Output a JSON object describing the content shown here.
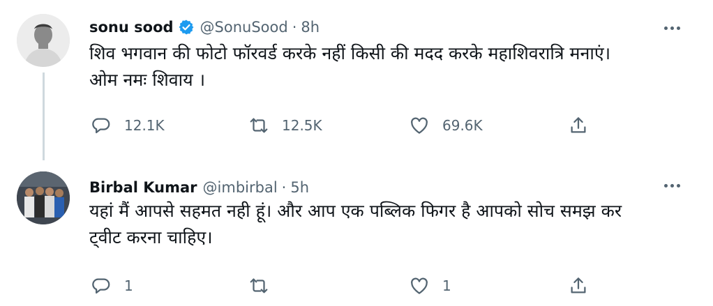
{
  "tweets": [
    {
      "name": "sonu sood",
      "handle": "@SonuSood",
      "separator": "·",
      "time": "8h",
      "text": "शिव भगवान की फोटो फॉरवर्ड करके नहीं किसी की मदद करके महाशिवरात्रि मनाएं।\n ओम नमः शिवाय ।",
      "verified": true,
      "replies": "12.1K",
      "retweets": "12.5K",
      "likes": "69.6K"
    },
    {
      "name": "Birbal Kumar",
      "handle": "@imbirbal",
      "separator": "·",
      "time": "5h",
      "text": "यहां मैं आपसे सहमत नही हूं। और आप एक पब्लिक फिगर है आपको सोच समझ कर\nट्वीट करना चाहिए।",
      "verified": false,
      "replies": "1",
      "retweets": "",
      "likes": "1"
    }
  ],
  "colors": {
    "accent": "#1d9bf0",
    "secondary_text": "#536471",
    "primary_text": "#0f1419"
  }
}
